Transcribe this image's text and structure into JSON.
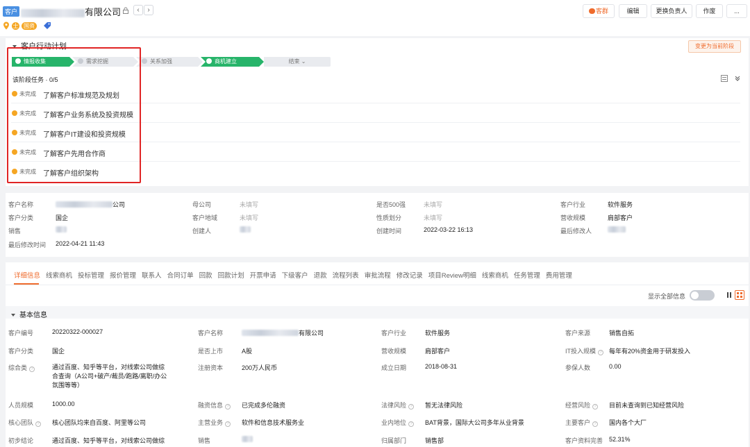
{
  "header": {
    "tag": "客户",
    "company_suffix": "有限公司",
    "badge_char": "士",
    "pill_badge": "国资",
    "actions": [
      "客群",
      "编辑",
      "更换负责人",
      "作废",
      "..."
    ]
  },
  "plan": {
    "title": "客户行动计划",
    "change_stage": "变更为当前阶段",
    "steps": [
      "情报收集",
      "需求挖掘",
      "关系加强",
      "商机建立",
      "结束"
    ],
    "task_header": "该阶段任务 · 0/5",
    "task_status": "未完成",
    "tasks": [
      "了解客户标准规范及规划",
      "了解客户业务系统及投资规模",
      "了解客户IT建设和投资规模",
      "了解客户先用合作商",
      "了解客户组织架构"
    ]
  },
  "summary": {
    "labels": [
      "客户名称",
      "客户分类",
      "销售",
      "最后修改时间",
      "母公司",
      "客户地域",
      "创建人",
      "是否500强",
      "性质划分",
      "创建时间",
      "客户行业",
      "营收规模",
      "最后修改人"
    ],
    "company_suffix": "公司",
    "category": "国企",
    "modified_time": "2022-04-21 11:43",
    "unfilled": "未填写",
    "created_time": "2022-03-22 16:13",
    "industry": "软件服务",
    "revenue": "肩部客户"
  },
  "detail": {
    "tabs": [
      "详细信息",
      "线索商机",
      "投标管理",
      "报价管理",
      "联系人",
      "合同订单",
      "回款",
      "回款计划",
      "开票申请",
      "下级客户",
      "退款",
      "流程列表",
      "审批流程",
      "修改记录",
      "项目Review明细",
      "线索商机",
      "任务管理",
      "费用管理"
    ],
    "show_all": "显示全部信息",
    "basic_title": "基本信息",
    "rows": [
      [
        {
          "k": "客户编号",
          "v": "20220322-000027"
        },
        {
          "k": "客户名称",
          "v": "有限公司"
        },
        {
          "k": "客户行业",
          "v": "软件服务"
        },
        {
          "k": "客户来源",
          "v": "销售自拓"
        }
      ],
      [
        {
          "k": "客户分类",
          "v": "国企"
        },
        {
          "k": "是否上市",
          "v": "A股"
        },
        {
          "k": "营收规模",
          "v": "肩部客户"
        },
        {
          "k": "IT投入规模",
          "v": "每年有20%资金用于研发投入"
        }
      ],
      [
        {
          "k": "综合类",
          "v": "通过百度、知乎等平台，对线索公司做综合查询（A公司+破产/裁员/跑路/离职/办公氛围等等）"
        },
        {
          "k": "注册资本",
          "v": "200万人民币"
        },
        {
          "k": "成立日期",
          "v": "2018-08-31"
        },
        {
          "k": "参保人数",
          "v": "0.00"
        }
      ],
      [
        {
          "k": "人员规模",
          "v": "1000.00"
        },
        {
          "k": "融资信息",
          "v": "已完成多伦融资"
        },
        {
          "k": "法律风险",
          "v": "暂无法律风险"
        },
        {
          "k": "经营风险",
          "v": "目前未查询到已知经营风险"
        }
      ],
      [
        {
          "k": "核心团队",
          "v": "核心团队均来自百度、阿里等公司"
        },
        {
          "k": "主营业务",
          "v": "软件和信息技术服务业"
        },
        {
          "k": "业内地位",
          "v": "BAT背景，国际大公司多年从业背景"
        },
        {
          "k": "主要客户",
          "v": "国内各个大厂"
        }
      ],
      [
        {
          "k": "初步结论",
          "v": "通过百度、知乎等平台，对线索公司做综"
        },
        {
          "k": "销售",
          "v": ""
        },
        {
          "k": "归属部门",
          "v": "销售部"
        },
        {
          "k": "客户资料完善",
          "v": "52.31%"
        }
      ]
    ]
  }
}
